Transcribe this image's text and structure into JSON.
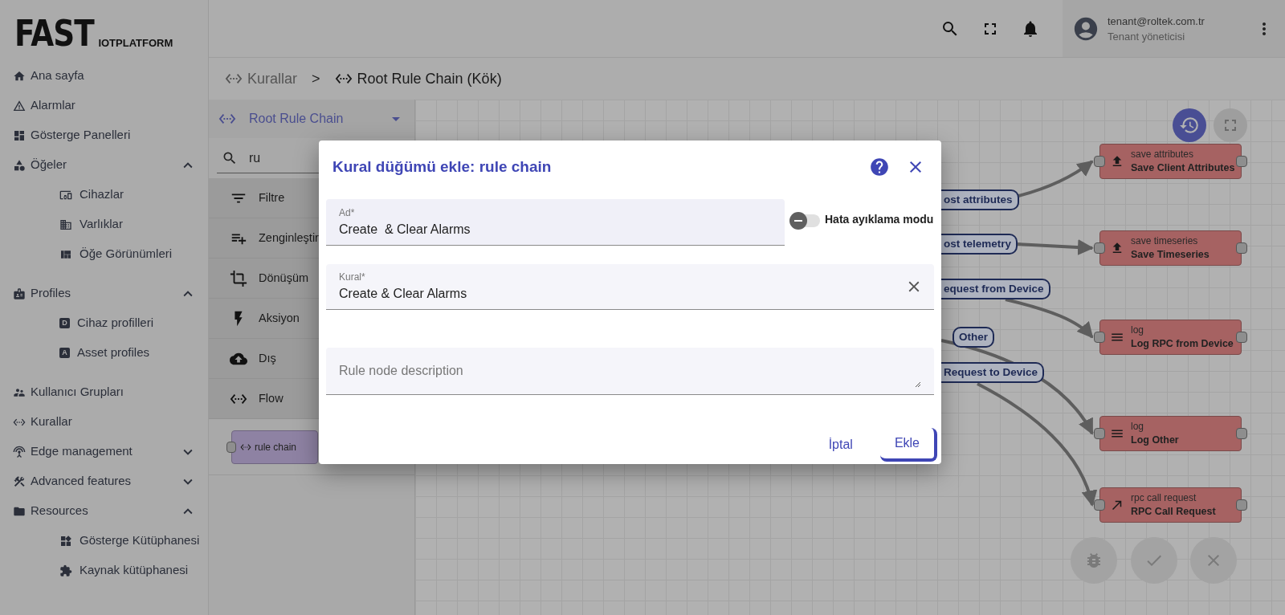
{
  "logo": {
    "main": "FAST",
    "sub": "IOTPLATFORM"
  },
  "sidebar": {
    "items": [
      {
        "label": "Ana sayfa"
      },
      {
        "label": "Alarmlar"
      },
      {
        "label": "Gösterge Panelleri"
      },
      {
        "label": "Öğeler",
        "expanded": true,
        "children": [
          {
            "label": "Cihazlar"
          },
          {
            "label": "Varlıklar"
          },
          {
            "label": "Öğe Görünümleri"
          }
        ]
      },
      {
        "label": "Profiles",
        "expanded": true,
        "children": [
          {
            "label": "Cihaz profilleri",
            "letter": "D"
          },
          {
            "label": "Asset profiles",
            "letter": "A"
          }
        ]
      },
      {
        "label": "Kullanıcı Grupları"
      },
      {
        "label": "Kurallar"
      },
      {
        "label": "Edge management",
        "expanded": false
      },
      {
        "label": "Advanced features",
        "expanded": false
      },
      {
        "label": "Resources",
        "expanded": true,
        "children": [
          {
            "label": "Gösterge Kütüphanesi"
          },
          {
            "label": "Kaynak kütüphanesi"
          }
        ]
      }
    ]
  },
  "topbar": {
    "user": {
      "email": "tenant@roltek.com.tr",
      "role": "Tenant yöneticisi"
    }
  },
  "breadcrumb": {
    "items": [
      "Kurallar",
      "Root Rule Chain (Kök)"
    ],
    "separator": ">"
  },
  "library": {
    "chain": "Root Rule Chain",
    "search": "ru",
    "categories": [
      "Filtre",
      "Zenginleştir",
      "Dönüşüm",
      "Aksiyon",
      "Dış",
      "Flow"
    ],
    "nodes": [
      "rule chain"
    ]
  },
  "canvas": {
    "nodes": [
      {
        "type": "save attributes",
        "name": "Save Client Attributes"
      },
      {
        "type": "save timeseries",
        "name": "Save Timeseries"
      },
      {
        "type": "log",
        "name": "Log RPC from Device"
      },
      {
        "type": "log",
        "name": "Log Other"
      },
      {
        "type": "rpc call request",
        "name": "RPC Call Request"
      }
    ],
    "links": [
      "ost attributes",
      "ost telemetry",
      "equest from Device",
      "Other",
      "Request to Device"
    ]
  },
  "dialog": {
    "title": "Kural düğümü ekle: rule chain",
    "name": {
      "label": "Ad*",
      "value": "Create  & Clear Alarms"
    },
    "debug": {
      "label": "Hata ayıklama modu",
      "on": false
    },
    "rule": {
      "label": "Kural*",
      "value": "Create & Clear Alarms"
    },
    "description": {
      "placeholder": "Rule node description"
    },
    "buttons": [
      "İptal",
      "Ekle"
    ]
  }
}
